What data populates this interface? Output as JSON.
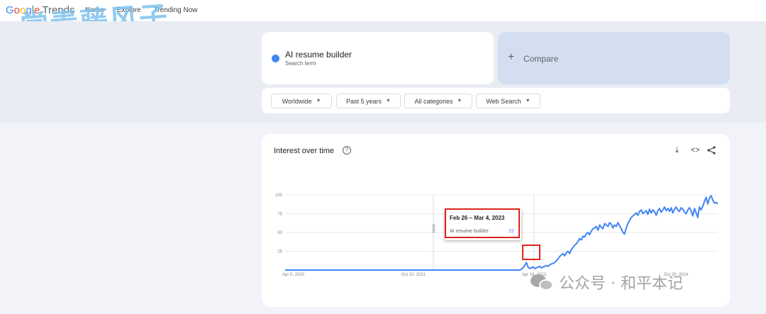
{
  "app": {
    "logo": {
      "g1": "G",
      "g2": "o",
      "g3": "o",
      "g4": "g",
      "g5": "l",
      "g6": "e",
      "product": "Trends"
    },
    "nav": [
      "Home",
      "Explore",
      "Trending Now"
    ],
    "watermark_top": "常青藤风子"
  },
  "search": {
    "term": "AI resume builder",
    "term_type": "Search term",
    "term_color": "#4285f4",
    "compare_label": "Compare",
    "compare_icon": "plus-icon"
  },
  "filters": [
    "Worldwide",
    "Past 5 years",
    "All categories",
    "Web Search"
  ],
  "chart_card": {
    "title": "Interest over time",
    "icons": [
      "help-icon",
      "download-icon",
      "embed-icon",
      "share-icon"
    ],
    "note_label": "Note",
    "tooltip": {
      "date": "Feb 26 – Mar 4, 2023",
      "term": "AI resume builder",
      "value": "22"
    }
  },
  "chart_data": {
    "type": "line",
    "title": "Interest over time",
    "xlabel": "",
    "ylabel": "",
    "ylim": [
      0,
      100
    ],
    "yticks": [
      "100",
      "75",
      "50",
      "25"
    ],
    "xticks": [
      "Apr 5, 2020",
      "Oct 10, 2021",
      "Apr 16, 2023",
      "Oct 20, 2024"
    ],
    "grid": true,
    "series": [
      {
        "name": "AI resume builder",
        "color": "#4285f4",
        "values": [
          0,
          0,
          0,
          0,
          0,
          0,
          0,
          0,
          0,
          0,
          0,
          0,
          0,
          0,
          0,
          0,
          0,
          0,
          0,
          0,
          0,
          0,
          0,
          0,
          0,
          0,
          0,
          0,
          0,
          0,
          0,
          0,
          0,
          0,
          0,
          0,
          0,
          0,
          0,
          0,
          0,
          0,
          0,
          0,
          0,
          0,
          0,
          0,
          0,
          0,
          0,
          0,
          0,
          0,
          0,
          0,
          0,
          0,
          0,
          0,
          0,
          0,
          0,
          0,
          0,
          0,
          0,
          0,
          0,
          0,
          0,
          0,
          0,
          0,
          0,
          0,
          0,
          0,
          0,
          0,
          0,
          0,
          0,
          0,
          0,
          0,
          0,
          0,
          0,
          0,
          0,
          0,
          0,
          0,
          0,
          0,
          0,
          0,
          0,
          0,
          0,
          0,
          0,
          0,
          0,
          0,
          0,
          0,
          0,
          0,
          0,
          0,
          0,
          0,
          0,
          0,
          0,
          0,
          0,
          0,
          0,
          0,
          0,
          0,
          0,
          0,
          0,
          0,
          0,
          0,
          0,
          0,
          0,
          0,
          0,
          0,
          0,
          0,
          0,
          0,
          0,
          0,
          1,
          3,
          6,
          10,
          4,
          2,
          3,
          4,
          2,
          3,
          4,
          5,
          3,
          4,
          5,
          6,
          5,
          7,
          8,
          9,
          10,
          12,
          15,
          18,
          20,
          22,
          19,
          23,
          25,
          22,
          27,
          30,
          33,
          35,
          38,
          42,
          40,
          45,
          44,
          48,
          50,
          47,
          52,
          55,
          56,
          58,
          53,
          60,
          57,
          55,
          62,
          60,
          58,
          63,
          61,
          56,
          60,
          58,
          63,
          59,
          55,
          50,
          48,
          56,
          62,
          66,
          70,
          72,
          74,
          76,
          73,
          78,
          80,
          75,
          77,
          79,
          74,
          81,
          76,
          80,
          78,
          73,
          79,
          82,
          77,
          80,
          84,
          79,
          82,
          78,
          83,
          76,
          81,
          84,
          80,
          78,
          83,
          81,
          77,
          75,
          80,
          83,
          79,
          72,
          82,
          76,
          70,
          84,
          80,
          85,
          91,
          97,
          88,
          96,
          99,
          93,
          89,
          90,
          88
        ]
      }
    ]
  },
  "overlay": {
    "wechat_watermark": "公众号 · 和平本记"
  },
  "colors": {
    "line": "#4285f4",
    "highlight": "#e2231a",
    "grid": "#e8eaed"
  }
}
